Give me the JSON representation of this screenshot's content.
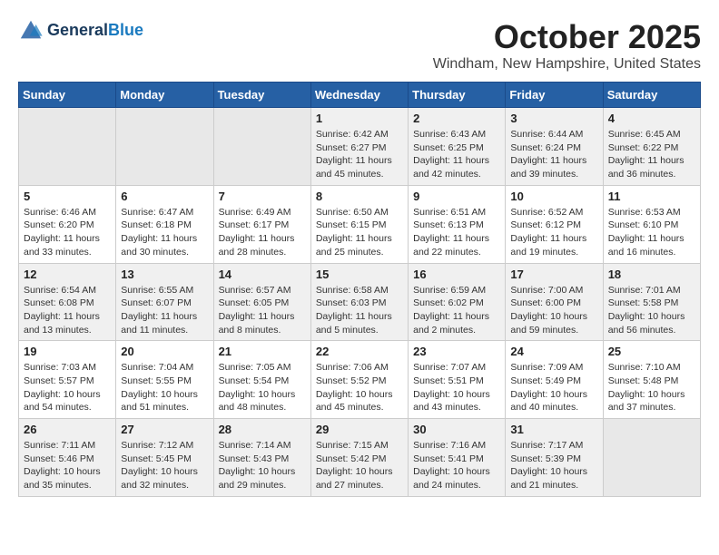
{
  "header": {
    "logo_line1": "General",
    "logo_line2": "Blue",
    "month": "October 2025",
    "location": "Windham, New Hampshire, United States"
  },
  "days_of_week": [
    "Sunday",
    "Monday",
    "Tuesday",
    "Wednesday",
    "Thursday",
    "Friday",
    "Saturday"
  ],
  "weeks": [
    [
      {
        "day": "",
        "info": ""
      },
      {
        "day": "",
        "info": ""
      },
      {
        "day": "",
        "info": ""
      },
      {
        "day": "1",
        "info": "Sunrise: 6:42 AM\nSunset: 6:27 PM\nDaylight: 11 hours\nand 45 minutes."
      },
      {
        "day": "2",
        "info": "Sunrise: 6:43 AM\nSunset: 6:25 PM\nDaylight: 11 hours\nand 42 minutes."
      },
      {
        "day": "3",
        "info": "Sunrise: 6:44 AM\nSunset: 6:24 PM\nDaylight: 11 hours\nand 39 minutes."
      },
      {
        "day": "4",
        "info": "Sunrise: 6:45 AM\nSunset: 6:22 PM\nDaylight: 11 hours\nand 36 minutes."
      }
    ],
    [
      {
        "day": "5",
        "info": "Sunrise: 6:46 AM\nSunset: 6:20 PM\nDaylight: 11 hours\nand 33 minutes."
      },
      {
        "day": "6",
        "info": "Sunrise: 6:47 AM\nSunset: 6:18 PM\nDaylight: 11 hours\nand 30 minutes."
      },
      {
        "day": "7",
        "info": "Sunrise: 6:49 AM\nSunset: 6:17 PM\nDaylight: 11 hours\nand 28 minutes."
      },
      {
        "day": "8",
        "info": "Sunrise: 6:50 AM\nSunset: 6:15 PM\nDaylight: 11 hours\nand 25 minutes."
      },
      {
        "day": "9",
        "info": "Sunrise: 6:51 AM\nSunset: 6:13 PM\nDaylight: 11 hours\nand 22 minutes."
      },
      {
        "day": "10",
        "info": "Sunrise: 6:52 AM\nSunset: 6:12 PM\nDaylight: 11 hours\nand 19 minutes."
      },
      {
        "day": "11",
        "info": "Sunrise: 6:53 AM\nSunset: 6:10 PM\nDaylight: 11 hours\nand 16 minutes."
      }
    ],
    [
      {
        "day": "12",
        "info": "Sunrise: 6:54 AM\nSunset: 6:08 PM\nDaylight: 11 hours\nand 13 minutes."
      },
      {
        "day": "13",
        "info": "Sunrise: 6:55 AM\nSunset: 6:07 PM\nDaylight: 11 hours\nand 11 minutes."
      },
      {
        "day": "14",
        "info": "Sunrise: 6:57 AM\nSunset: 6:05 PM\nDaylight: 11 hours\nand 8 minutes."
      },
      {
        "day": "15",
        "info": "Sunrise: 6:58 AM\nSunset: 6:03 PM\nDaylight: 11 hours\nand 5 minutes."
      },
      {
        "day": "16",
        "info": "Sunrise: 6:59 AM\nSunset: 6:02 PM\nDaylight: 11 hours\nand 2 minutes."
      },
      {
        "day": "17",
        "info": "Sunrise: 7:00 AM\nSunset: 6:00 PM\nDaylight: 10 hours\nand 59 minutes."
      },
      {
        "day": "18",
        "info": "Sunrise: 7:01 AM\nSunset: 5:58 PM\nDaylight: 10 hours\nand 56 minutes."
      }
    ],
    [
      {
        "day": "19",
        "info": "Sunrise: 7:03 AM\nSunset: 5:57 PM\nDaylight: 10 hours\nand 54 minutes."
      },
      {
        "day": "20",
        "info": "Sunrise: 7:04 AM\nSunset: 5:55 PM\nDaylight: 10 hours\nand 51 minutes."
      },
      {
        "day": "21",
        "info": "Sunrise: 7:05 AM\nSunset: 5:54 PM\nDaylight: 10 hours\nand 48 minutes."
      },
      {
        "day": "22",
        "info": "Sunrise: 7:06 AM\nSunset: 5:52 PM\nDaylight: 10 hours\nand 45 minutes."
      },
      {
        "day": "23",
        "info": "Sunrise: 7:07 AM\nSunset: 5:51 PM\nDaylight: 10 hours\nand 43 minutes."
      },
      {
        "day": "24",
        "info": "Sunrise: 7:09 AM\nSunset: 5:49 PM\nDaylight: 10 hours\nand 40 minutes."
      },
      {
        "day": "25",
        "info": "Sunrise: 7:10 AM\nSunset: 5:48 PM\nDaylight: 10 hours\nand 37 minutes."
      }
    ],
    [
      {
        "day": "26",
        "info": "Sunrise: 7:11 AM\nSunset: 5:46 PM\nDaylight: 10 hours\nand 35 minutes."
      },
      {
        "day": "27",
        "info": "Sunrise: 7:12 AM\nSunset: 5:45 PM\nDaylight: 10 hours\nand 32 minutes."
      },
      {
        "day": "28",
        "info": "Sunrise: 7:14 AM\nSunset: 5:43 PM\nDaylight: 10 hours\nand 29 minutes."
      },
      {
        "day": "29",
        "info": "Sunrise: 7:15 AM\nSunset: 5:42 PM\nDaylight: 10 hours\nand 27 minutes."
      },
      {
        "day": "30",
        "info": "Sunrise: 7:16 AM\nSunset: 5:41 PM\nDaylight: 10 hours\nand 24 minutes."
      },
      {
        "day": "31",
        "info": "Sunrise: 7:17 AM\nSunset: 5:39 PM\nDaylight: 10 hours\nand 21 minutes."
      },
      {
        "day": "",
        "info": ""
      }
    ]
  ]
}
